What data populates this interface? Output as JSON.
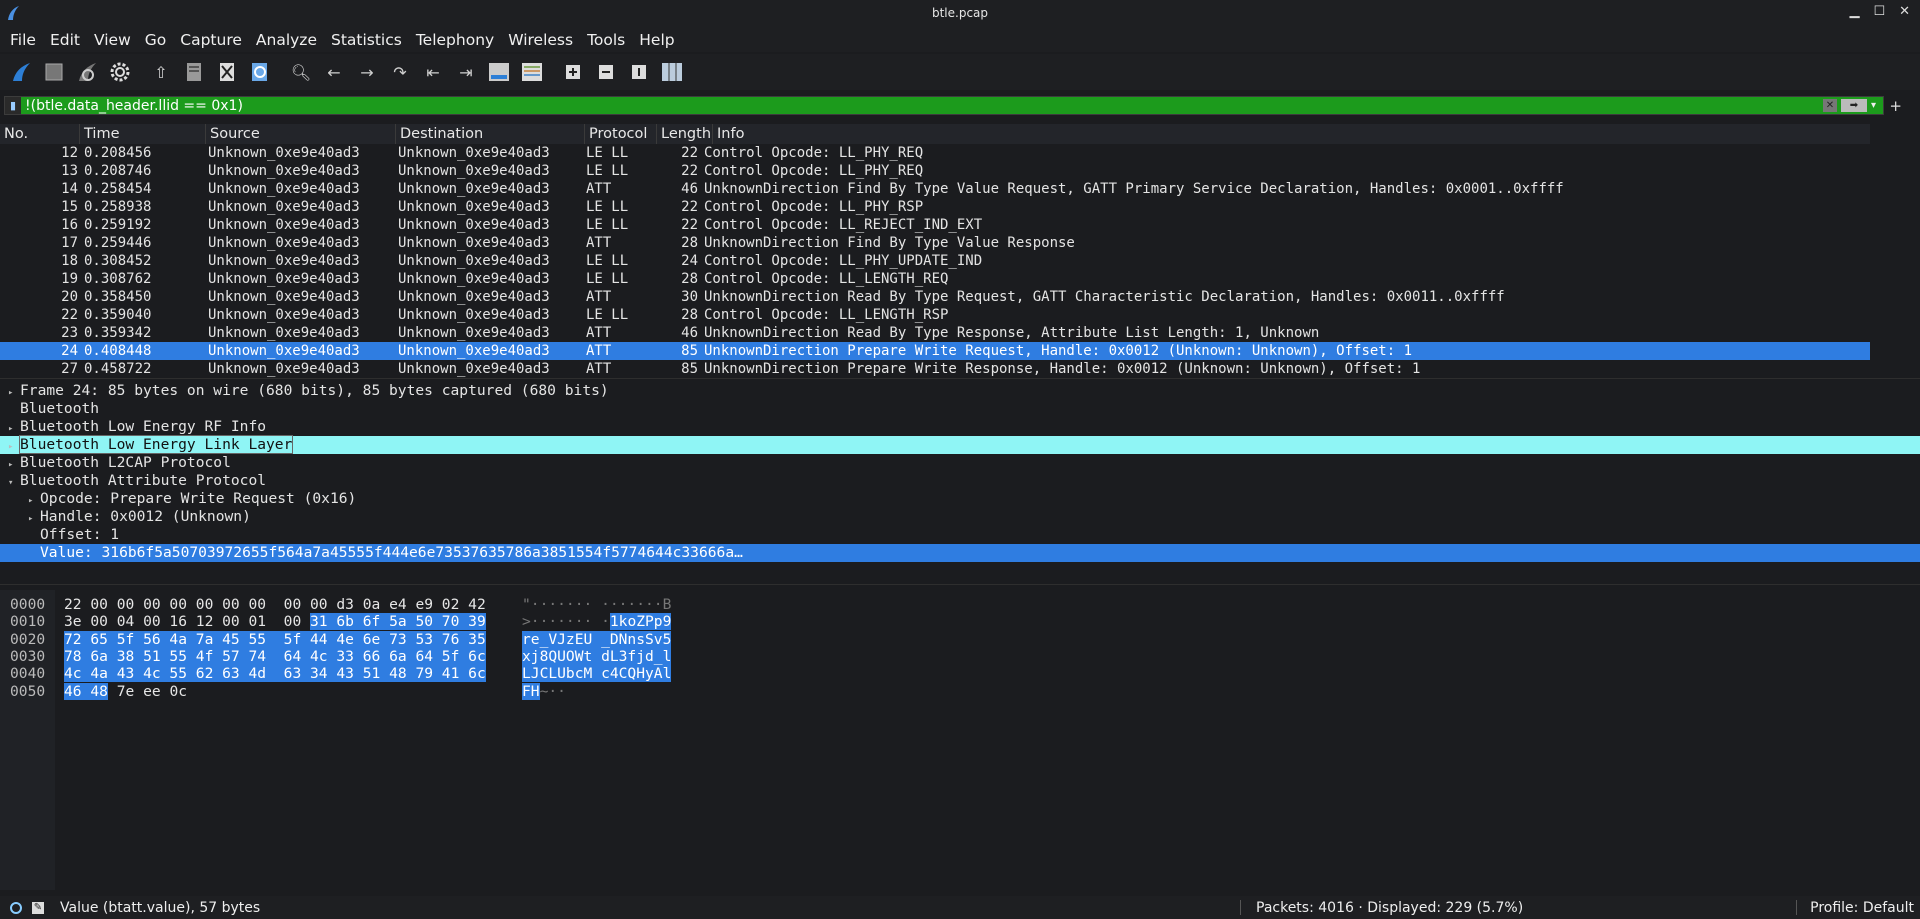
{
  "window": {
    "title": "btle.pcap"
  },
  "menu": [
    "File",
    "Edit",
    "View",
    "Go",
    "Capture",
    "Analyze",
    "Statistics",
    "Telephony",
    "Wireless",
    "Tools",
    "Help"
  ],
  "toolbar_icons": [
    "shark-fin-start-icon",
    "stop-icon",
    "restart-icon",
    "options-gear-icon",
    "open-file-icon",
    "save-file-icon",
    "close-file-icon",
    "reload-icon",
    "find-icon",
    "go-back-icon",
    "go-forward-icon",
    "go-to-packet-icon",
    "first-packet-icon",
    "last-packet-icon",
    "autoscroll-icon",
    "colorize-icon",
    "zoom-in-icon",
    "zoom-out-icon",
    "normal-size-icon",
    "resize-columns-icon"
  ],
  "filter": {
    "value": "!(btle.data_header.llid == 0x1)"
  },
  "columns": [
    "No.",
    "Time",
    "Source",
    "Destination",
    "Protocol",
    "Length",
    "Info"
  ],
  "packets": [
    {
      "no": "12",
      "time": "0.208456",
      "src": "Unknown_0xe9e40ad3",
      "dst": "Unknown_0xe9e40ad3",
      "proto": "LE LL",
      "len": "22",
      "info": "Control Opcode: LL_PHY_REQ"
    },
    {
      "no": "13",
      "time": "0.208746",
      "src": "Unknown_0xe9e40ad3",
      "dst": "Unknown_0xe9e40ad3",
      "proto": "LE LL",
      "len": "22",
      "info": "Control Opcode: LL_PHY_REQ"
    },
    {
      "no": "14",
      "time": "0.258454",
      "src": "Unknown_0xe9e40ad3",
      "dst": "Unknown_0xe9e40ad3",
      "proto": "ATT",
      "len": "46",
      "info": "UnknownDirection Find By Type Value Request, GATT Primary Service Declaration, Handles: 0x0001..0xffff"
    },
    {
      "no": "15",
      "time": "0.258938",
      "src": "Unknown_0xe9e40ad3",
      "dst": "Unknown_0xe9e40ad3",
      "proto": "LE LL",
      "len": "22",
      "info": "Control Opcode: LL_PHY_RSP"
    },
    {
      "no": "16",
      "time": "0.259192",
      "src": "Unknown_0xe9e40ad3",
      "dst": "Unknown_0xe9e40ad3",
      "proto": "LE LL",
      "len": "22",
      "info": "Control Opcode: LL_REJECT_IND_EXT"
    },
    {
      "no": "17",
      "time": "0.259446",
      "src": "Unknown_0xe9e40ad3",
      "dst": "Unknown_0xe9e40ad3",
      "proto": "ATT",
      "len": "28",
      "info": "UnknownDirection Find By Type Value Response"
    },
    {
      "no": "18",
      "time": "0.308452",
      "src": "Unknown_0xe9e40ad3",
      "dst": "Unknown_0xe9e40ad3",
      "proto": "LE LL",
      "len": "24",
      "info": "Control Opcode: LL_PHY_UPDATE_IND"
    },
    {
      "no": "19",
      "time": "0.308762",
      "src": "Unknown_0xe9e40ad3",
      "dst": "Unknown_0xe9e40ad3",
      "proto": "LE LL",
      "len": "28",
      "info": "Control Opcode: LL_LENGTH_REQ"
    },
    {
      "no": "20",
      "time": "0.358450",
      "src": "Unknown_0xe9e40ad3",
      "dst": "Unknown_0xe9e40ad3",
      "proto": "ATT",
      "len": "30",
      "info": "UnknownDirection Read By Type Request, GATT Characteristic Declaration, Handles: 0x0011..0xffff"
    },
    {
      "no": "22",
      "time": "0.359040",
      "src": "Unknown_0xe9e40ad3",
      "dst": "Unknown_0xe9e40ad3",
      "proto": "LE LL",
      "len": "28",
      "info": "Control Opcode: LL_LENGTH_RSP"
    },
    {
      "no": "23",
      "time": "0.359342",
      "src": "Unknown_0xe9e40ad3",
      "dst": "Unknown_0xe9e40ad3",
      "proto": "ATT",
      "len": "46",
      "info": "UnknownDirection Read By Type Response, Attribute List Length: 1, Unknown"
    },
    {
      "no": "24",
      "time": "0.408448",
      "src": "Unknown_0xe9e40ad3",
      "dst": "Unknown_0xe9e40ad3",
      "proto": "ATT",
      "len": "85",
      "info": "UnknownDirection Prepare Write Request, Handle: 0x0012 (Unknown: Unknown), Offset: 1",
      "selected": true
    },
    {
      "no": "27",
      "time": "0.458722",
      "src": "Unknown_0xe9e40ad3",
      "dst": "Unknown_0xe9e40ad3",
      "proto": "ATT",
      "len": "85",
      "info": "UnknownDirection Prepare Write Response, Handle: 0x0012 (Unknown: Unknown), Offset: 1"
    }
  ],
  "details": [
    {
      "indent": 0,
      "arrow": "▸",
      "text": "Frame 24: 85 bytes on wire (680 bits), 85 bytes captured (680 bits)"
    },
    {
      "indent": 0,
      "arrow": "",
      "text": "Bluetooth"
    },
    {
      "indent": 0,
      "arrow": "▸",
      "text": "Bluetooth Low Energy RF Info"
    },
    {
      "indent": 0,
      "arrow": "▸",
      "text": "Bluetooth Low Energy Link Layer",
      "highlight": true
    },
    {
      "indent": 0,
      "arrow": "▸",
      "text": "Bluetooth L2CAP Protocol"
    },
    {
      "indent": 0,
      "arrow": "▾",
      "text": "Bluetooth Attribute Protocol"
    },
    {
      "indent": 1,
      "arrow": "▸",
      "text": "Opcode: Prepare Write Request (0x16)"
    },
    {
      "indent": 1,
      "arrow": "▸",
      "text": "Handle: 0x0012 (Unknown)"
    },
    {
      "indent": 1,
      "arrow": "",
      "text": "Offset: 1"
    },
    {
      "indent": 1,
      "arrow": "",
      "text": "Value: 316b6f5a50703972655f564a7a45555f444e6e73537635786a3851554f5774644c33666a…",
      "selected": true
    }
  ],
  "bytes": [
    {
      "off": "0000",
      "hex_plain": "22 00 00 00 00 00 00 00  00 00 d3 0a e4 e9 02 42",
      "hex_hl": "",
      "ascii_plain": "\"······· ·······B",
      "ascii_hl": ""
    },
    {
      "off": "0010",
      "hex_plain": "3e 00 04 00 16 12 00 01  00 ",
      "hex_hl": "31 6b 6f 5a 50 70 39",
      "ascii_plain": ">······· ·",
      "ascii_hl": "1koZPp9"
    },
    {
      "off": "0020",
      "hex_plain": "",
      "hex_hl": "72 65 5f 56 4a 7a 45 55  5f 44 4e 6e 73 53 76 35",
      "ascii_plain": "",
      "ascii_hl": "re_VJzEU _DNnsSv5"
    },
    {
      "off": "0030",
      "hex_plain": "",
      "hex_hl": "78 6a 38 51 55 4f 57 74  64 4c 33 66 6a 64 5f 6c",
      "ascii_plain": "",
      "ascii_hl": "xj8QUOWt dL3fjd_l"
    },
    {
      "off": "0040",
      "hex_plain": "",
      "hex_hl": "4c 4a 43 4c 55 62 63 4d  63 34 43 51 48 79 41 6c",
      "ascii_plain": "",
      "ascii_hl": "LJCLUbcM c4CQHyAl"
    },
    {
      "off": "0050",
      "hex_plain": "",
      "hex_hl": "46 48",
      "hex_tail": " 7e ee 0c",
      "ascii_plain": "",
      "ascii_hl": "FH",
      "ascii_tail": "~··"
    }
  ],
  "status": {
    "field": "Value (btatt.value), 57 bytes",
    "packets": "Packets: 4016 · Displayed: 229 (5.7%)",
    "profile": "Profile: Default"
  },
  "colors": {
    "selection": "#2f7de1",
    "filter_ok": "#1c9b1c",
    "highlight": "#8ff5f5"
  }
}
